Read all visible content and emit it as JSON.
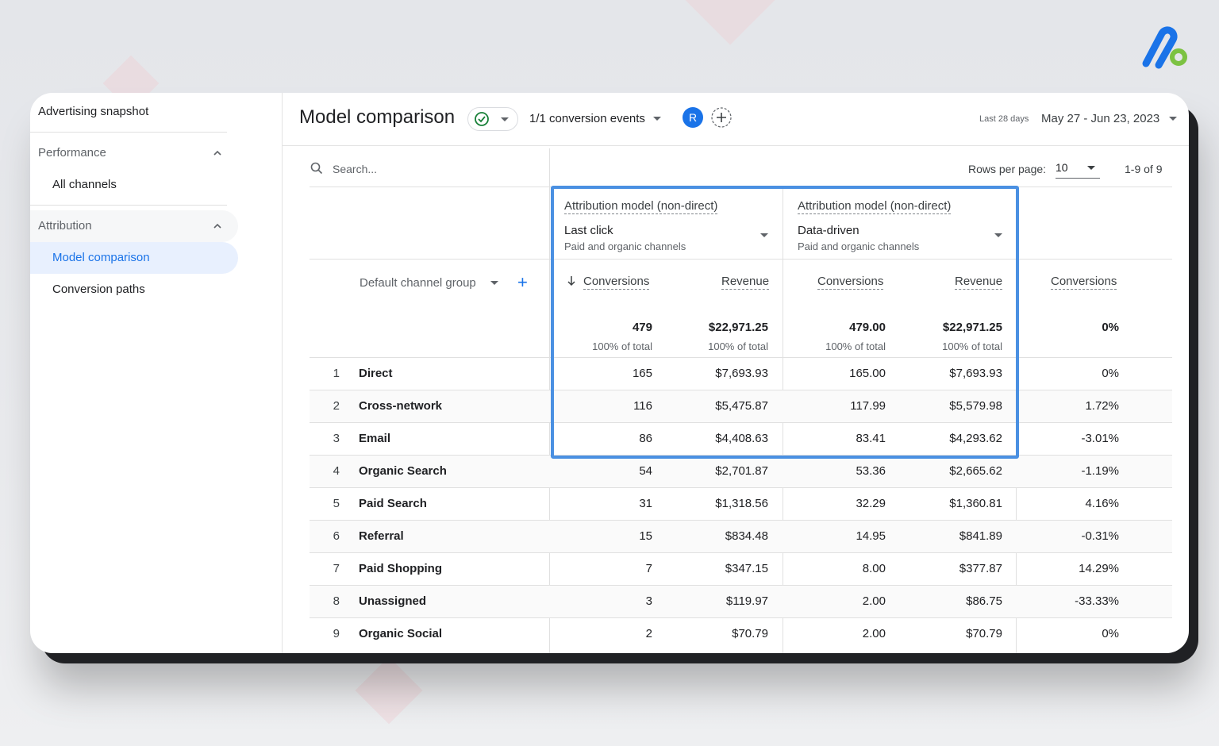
{
  "sidebar": {
    "title": "Advertising snapshot",
    "groups": [
      {
        "label": "Performance",
        "items": [
          "All channels"
        ]
      },
      {
        "label": "Attribution",
        "items": [
          "Model comparison",
          "Conversion paths"
        ]
      }
    ]
  },
  "header": {
    "title": "Model comparison",
    "conversion_events": "1/1 conversion events",
    "avatar_initial": "R",
    "date_small": "Last 28 days",
    "date_range": "May 27 - Jun 23, 2023"
  },
  "toolbar": {
    "search_placeholder": "Search...",
    "rows_per_page_label": "Rows per page:",
    "rows_per_page_value": "10",
    "pager": "1-9 of 9"
  },
  "models": [
    {
      "label": "Attribution model (non-direct)",
      "name": "Last click",
      "sub": "Paid and organic channels"
    },
    {
      "label": "Attribution model (non-direct)",
      "name": "Data-driven",
      "sub": "Paid and organic channels"
    }
  ],
  "dimension_label": "Default channel group",
  "columns": [
    "Conversions",
    "Revenue",
    "Conversions",
    "Revenue",
    "Conversions"
  ],
  "totals": {
    "values": [
      "479",
      "$22,971.25",
      "479.00",
      "$22,971.25",
      "0%"
    ],
    "subs": [
      "100% of total",
      "100% of total",
      "100% of total",
      "100% of total"
    ]
  },
  "rows": [
    {
      "idx": "1",
      "name": "Direct",
      "c1": "165",
      "r1": "$7,693.93",
      "c2": "165.00",
      "r2": "$7,693.93",
      "pct": "0%"
    },
    {
      "idx": "2",
      "name": "Cross-network",
      "c1": "116",
      "r1": "$5,475.87",
      "c2": "117.99",
      "r2": "$5,579.98",
      "pct": "1.72%"
    },
    {
      "idx": "3",
      "name": "Email",
      "c1": "86",
      "r1": "$4,408.63",
      "c2": "83.41",
      "r2": "$4,293.62",
      "pct": "-3.01%"
    },
    {
      "idx": "4",
      "name": "Organic Search",
      "c1": "54",
      "r1": "$2,701.87",
      "c2": "53.36",
      "r2": "$2,665.62",
      "pct": "-1.19%"
    },
    {
      "idx": "5",
      "name": "Paid Search",
      "c1": "31",
      "r1": "$1,318.56",
      "c2": "32.29",
      "r2": "$1,360.81",
      "pct": "4.16%"
    },
    {
      "idx": "6",
      "name": "Referral",
      "c1": "15",
      "r1": "$834.48",
      "c2": "14.95",
      "r2": "$841.89",
      "pct": "-0.31%"
    },
    {
      "idx": "7",
      "name": "Paid Shopping",
      "c1": "7",
      "r1": "$347.15",
      "c2": "8.00",
      "r2": "$377.87",
      "pct": "14.29%"
    },
    {
      "idx": "8",
      "name": "Unassigned",
      "c1": "3",
      "r1": "$119.97",
      "c2": "2.00",
      "r2": "$86.75",
      "pct": "-33.33%"
    },
    {
      "idx": "9",
      "name": "Organic Social",
      "c1": "2",
      "r1": "$70.79",
      "c2": "2.00",
      "r2": "$70.79",
      "pct": "0%"
    }
  ],
  "colors": {
    "accent": "#1a73e8",
    "highlight": "#4a90e2",
    "success": "#188038"
  }
}
